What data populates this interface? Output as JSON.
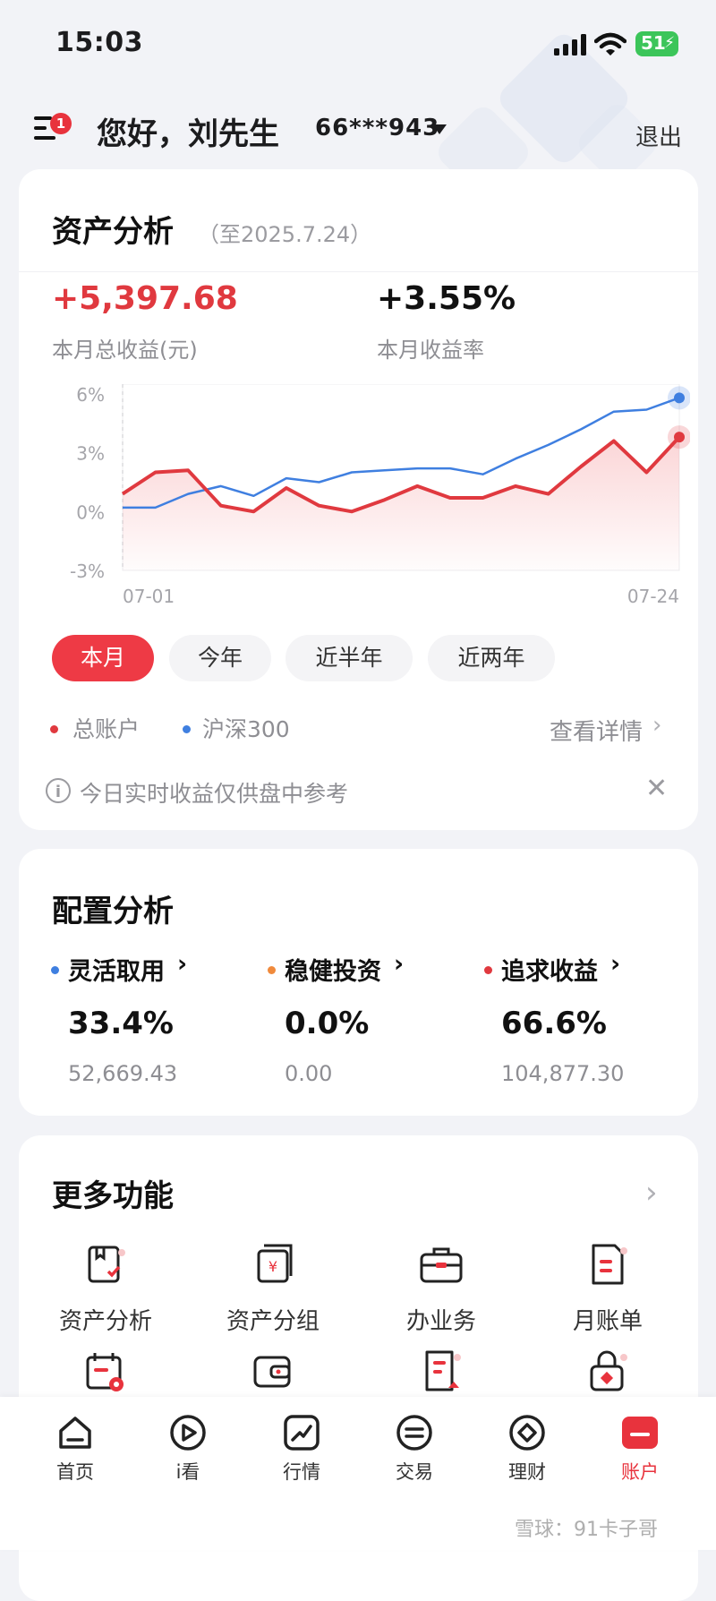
{
  "status_bar": {
    "time": "15:03",
    "battery": "51"
  },
  "header": {
    "menu_badge": "1",
    "greeting": "您好，刘先生",
    "account_number": "66***943",
    "logout_label": "退出"
  },
  "asset_analysis": {
    "title": "资产分析",
    "as_of": "（至2025.7.24）",
    "monthly_profit_value": "+5,397.68",
    "monthly_profit_label": "本月总收益(元)",
    "monthly_return_value": "+3.55%",
    "monthly_return_label": "本月收益率",
    "period_tabs": [
      {
        "label": "本月",
        "active": true
      },
      {
        "label": "今年",
        "active": false
      },
      {
        "label": "近半年",
        "active": false
      },
      {
        "label": "近两年",
        "active": false
      }
    ],
    "legend": [
      {
        "label": "总账户",
        "color": "#e0393f"
      },
      {
        "label": "沪深300",
        "color": "#3f7fe0"
      }
    ],
    "view_details_label": "查看详情",
    "info_text": "今日实时收益仅供盘中参考"
  },
  "chart_data": {
    "type": "line",
    "x_start": "07-01",
    "x_end": "07-24",
    "ylim": [
      -3,
      6.5
    ],
    "yticks": [
      {
        "value": 6,
        "label": "6%"
      },
      {
        "value": 3,
        "label": "3%"
      },
      {
        "value": 0,
        "label": "0%"
      },
      {
        "value": -3,
        "label": "-3%"
      }
    ],
    "xticks": [
      "07-01",
      "07-24"
    ],
    "grid": true,
    "series": [
      {
        "name": "总账户",
        "color": "#e0393f",
        "area": true,
        "values": [
          0.9,
          2.0,
          2.1,
          0.3,
          0.0,
          1.2,
          0.3,
          0.0,
          0.6,
          1.3,
          0.7,
          0.7,
          1.3,
          0.9,
          2.3,
          3.6,
          2.0,
          3.8
        ]
      },
      {
        "name": "沪深300",
        "color": "#3f7fe0",
        "area": false,
        "values": [
          0.2,
          0.2,
          0.9,
          1.3,
          0.8,
          1.7,
          1.5,
          2.0,
          2.1,
          2.2,
          2.2,
          1.9,
          2.7,
          3.4,
          4.2,
          5.1,
          5.2,
          5.8
        ]
      }
    ]
  },
  "allocation": {
    "title": "配置分析",
    "items": [
      {
        "name": "灵活取用",
        "color": "#3f7fe0",
        "percent": "33.4%",
        "amount": "52,669.43"
      },
      {
        "name": "稳健投资",
        "color": "#f08a3c",
        "percent": "0.0%",
        "amount": "0.00"
      },
      {
        "name": "追求收益",
        "color": "#e0393f",
        "percent": "66.6%",
        "amount": "104,877.30"
      }
    ]
  },
  "more_functions": {
    "title": "更多功能",
    "items": [
      {
        "label": "资产分析",
        "icon": "asset-analysis-icon"
      },
      {
        "label": "资产分组",
        "icon": "asset-group-icon"
      },
      {
        "label": "办业务",
        "icon": "briefcase-icon"
      },
      {
        "label": "月账单",
        "icon": "monthly-bill-icon"
      },
      {
        "label": "",
        "icon": "calendar-icon"
      },
      {
        "label": "",
        "icon": "wallet-icon"
      },
      {
        "label": "",
        "icon": "document-upload-icon"
      },
      {
        "label": "",
        "icon": "lock-icon"
      }
    ]
  },
  "bottom_nav": {
    "items": [
      {
        "label": "首页",
        "icon": "home-icon",
        "active": false
      },
      {
        "label": "i看",
        "icon": "play-icon",
        "active": false
      },
      {
        "label": "行情",
        "icon": "trend-icon",
        "active": false
      },
      {
        "label": "交易",
        "icon": "exchange-icon",
        "active": false
      },
      {
        "label": "理财",
        "icon": "finance-icon",
        "active": false
      },
      {
        "label": "账户",
        "icon": "account-icon",
        "active": true
      }
    ]
  },
  "watermark": "雪球：91卡子哥"
}
